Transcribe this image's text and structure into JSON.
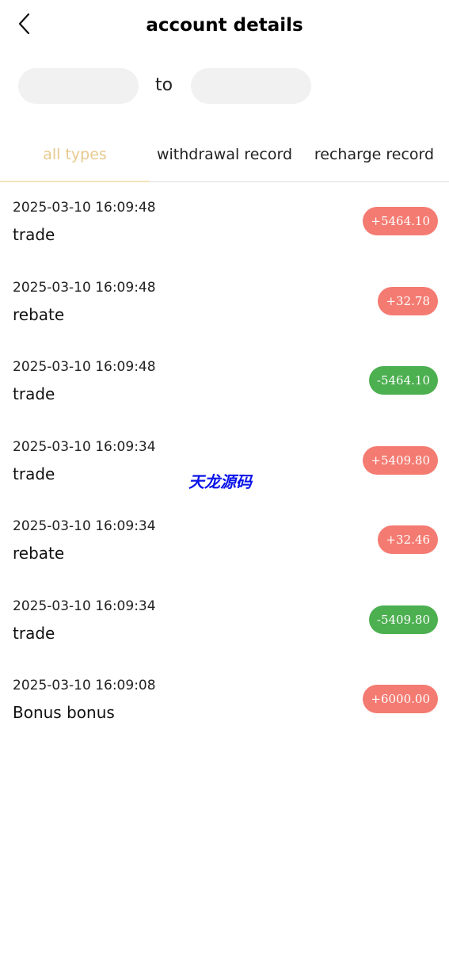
{
  "header": {
    "title": "account details",
    "back_icon": "chevron-left-icon"
  },
  "date_range": {
    "start_value": "",
    "end_value": "",
    "to_label": "to"
  },
  "tabs": [
    {
      "label": "all types",
      "active": true
    },
    {
      "label": "withdrawal record",
      "active": false
    },
    {
      "label": "recharge record",
      "active": false
    }
  ],
  "records": [
    {
      "time": "2025-03-10 16:09:48",
      "type": "trade",
      "amount": "+5464.10",
      "sign": "positive"
    },
    {
      "time": "2025-03-10 16:09:48",
      "type": "rebate",
      "amount": "+32.78",
      "sign": "positive"
    },
    {
      "time": "2025-03-10 16:09:48",
      "type": "trade",
      "amount": "-5464.10",
      "sign": "negative"
    },
    {
      "time": "2025-03-10 16:09:34",
      "type": "trade",
      "amount": "+5409.80",
      "sign": "positive"
    },
    {
      "time": "2025-03-10 16:09:34",
      "type": "rebate",
      "amount": "+32.46",
      "sign": "positive"
    },
    {
      "time": "2025-03-10 16:09:34",
      "type": "trade",
      "amount": "-5409.80",
      "sign": "negative"
    },
    {
      "time": "2025-03-10 16:09:08",
      "type": "Bonus bonus",
      "amount": "+6000.00",
      "sign": "positive"
    }
  ],
  "watermark": "天龙源码",
  "colors": {
    "active_tab": "#e7c98e",
    "positive_badge": "#f47b72",
    "negative_badge": "#4caf50",
    "date_input_bg": "#f1f1f1"
  }
}
